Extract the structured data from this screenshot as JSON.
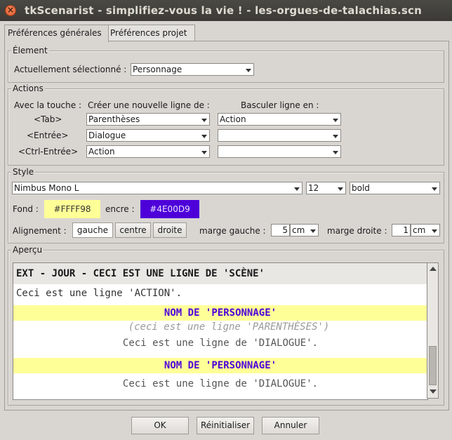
{
  "window": {
    "title": "tkScenarist - simplifiez-vous la vie ! - les-orgues-de-talachias.scn"
  },
  "tabs": [
    {
      "label": "Préférences générales"
    },
    {
      "label": "Préférences projet"
    }
  ],
  "element_group": {
    "legend": "Élement",
    "selected_label": "Actuellement sélectionné :",
    "selected_value": "Personnage"
  },
  "actions_group": {
    "legend": "Actions",
    "col_key": "Avec la touche :",
    "col_new_line": "Créer une nouvelle ligne de :",
    "col_toggle": "Basculer ligne en :",
    "rows": [
      {
        "key": "<Tab>",
        "new_line": "Parenthèses",
        "toggle": "Action"
      },
      {
        "key": "<Entrée>",
        "new_line": "Dialogue",
        "toggle": ""
      },
      {
        "key": "<Ctrl-Entrée>",
        "new_line": "Action",
        "toggle": ""
      }
    ]
  },
  "style_group": {
    "legend": "Style",
    "font_family": "Nimbus Mono L",
    "font_size": "12",
    "font_weight": "bold",
    "background_label": "Fond :",
    "background_value": "#FFFF98",
    "ink_label": "encre :",
    "ink_value": "#4E00D9",
    "alignment_label": "Alignement :",
    "align_left": "gauche",
    "align_center": "centre",
    "align_right": "droite",
    "margin_left_label": "marge gauche :",
    "margin_left_value": "5",
    "margin_left_unit": "cm",
    "margin_right_label": "marge droite :",
    "margin_right_value": "1",
    "margin_right_unit": "cm"
  },
  "preview_group": {
    "legend": "Aperçu",
    "lines": [
      {
        "text": "EXT - JOUR - CECI EST UNE LIGNE DE 'SCÈNE'"
      },
      {
        "text": "Ceci est une ligne 'ACTION'."
      },
      {
        "text": "NOM DE 'PERSONNAGE'"
      },
      {
        "text": "(ceci est une ligne 'PARENTHÈSES')"
      },
      {
        "text": "Ceci est une ligne de 'DIALOGUE'."
      },
      {
        "text": "NOM DE 'PERSONNAGE'"
      },
      {
        "text": "Ceci est une ligne de 'DIALOGUE'."
      }
    ]
  },
  "buttons": {
    "ok": "OK",
    "reset": "Réinitialiser",
    "cancel": "Annuler"
  },
  "colors": {
    "highlight_bg": "#FFFF98",
    "highlight_ink": "#4E00D9",
    "scene_bg": "#E9E7E3"
  }
}
